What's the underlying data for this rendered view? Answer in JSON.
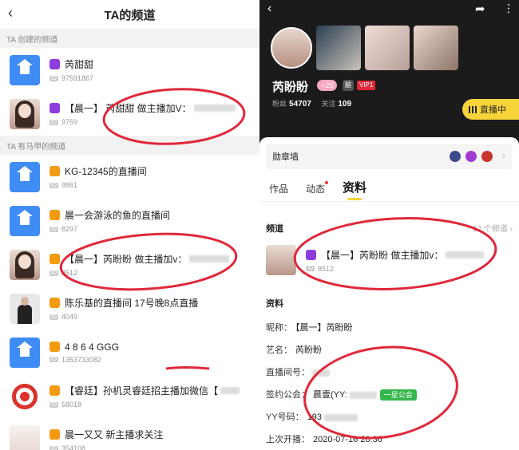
{
  "left": {
    "title": "TA的频道",
    "section_created": "TA 创建的频道",
    "section_vest": "TA 有马甲的频道",
    "id_tag": "ID",
    "created": [
      {
        "name": "芮甜甜",
        "id": "97591867"
      },
      {
        "name": "【晨一】 芮甜甜 做主播加V：",
        "id": "9759"
      }
    ],
    "vest": [
      {
        "name": "KG-12345的直播间",
        "id": "9861"
      },
      {
        "name": "晨一会游泳的鱼的直播间",
        "id": "8297"
      },
      {
        "name": "【晨一】芮盼盼 做主播加v：",
        "id": "8512"
      },
      {
        "name": "陈乐基的直播间 17号晚8点直播",
        "id": "4049"
      },
      {
        "name": "4 8 6 4 GGG",
        "id": "1353733082"
      },
      {
        "name": "【睿廷】孙机灵睿廷招主播加微信【",
        "id": "58018"
      },
      {
        "name": "晨一又又   新主播求关注",
        "id": "354108"
      }
    ]
  },
  "right": {
    "username": "芮盼盼",
    "level": "20",
    "level_badge": "脑",
    "vip": "VIP1",
    "fans_label": "粉丝",
    "fans": "54707",
    "follow_label": "关注",
    "follow": "109",
    "live_btn": "直播中",
    "medal_wall": "勋章墙",
    "tabs": [
      "作品",
      "动态",
      "资料"
    ],
    "channel_label": "频道",
    "channel_count": "12 个频道",
    "channel_name": "【晨一】芮盼盼 做主播加v：",
    "channel_id": "8512",
    "profile_label": "资料",
    "nickname_label": "昵称：",
    "nickname": "【晨一】芮盼盼",
    "stage_label": "艺名：",
    "stage": "芮盼盼",
    "room_label": "直播间号：",
    "guild_label": "签约公会：",
    "guild": "晨壹(YY:",
    "guild_badge": "一星公会",
    "yy_label": "YY号码：",
    "yy": "193",
    "last_label": "上次开播：",
    "last": "2020-07-16 20:36"
  },
  "colors": {
    "accent_yellow": "#f7d43a",
    "annotation_red": "#e0283a",
    "badge_purple": "#8d3ddb",
    "badge_orange": "#f39a11"
  }
}
